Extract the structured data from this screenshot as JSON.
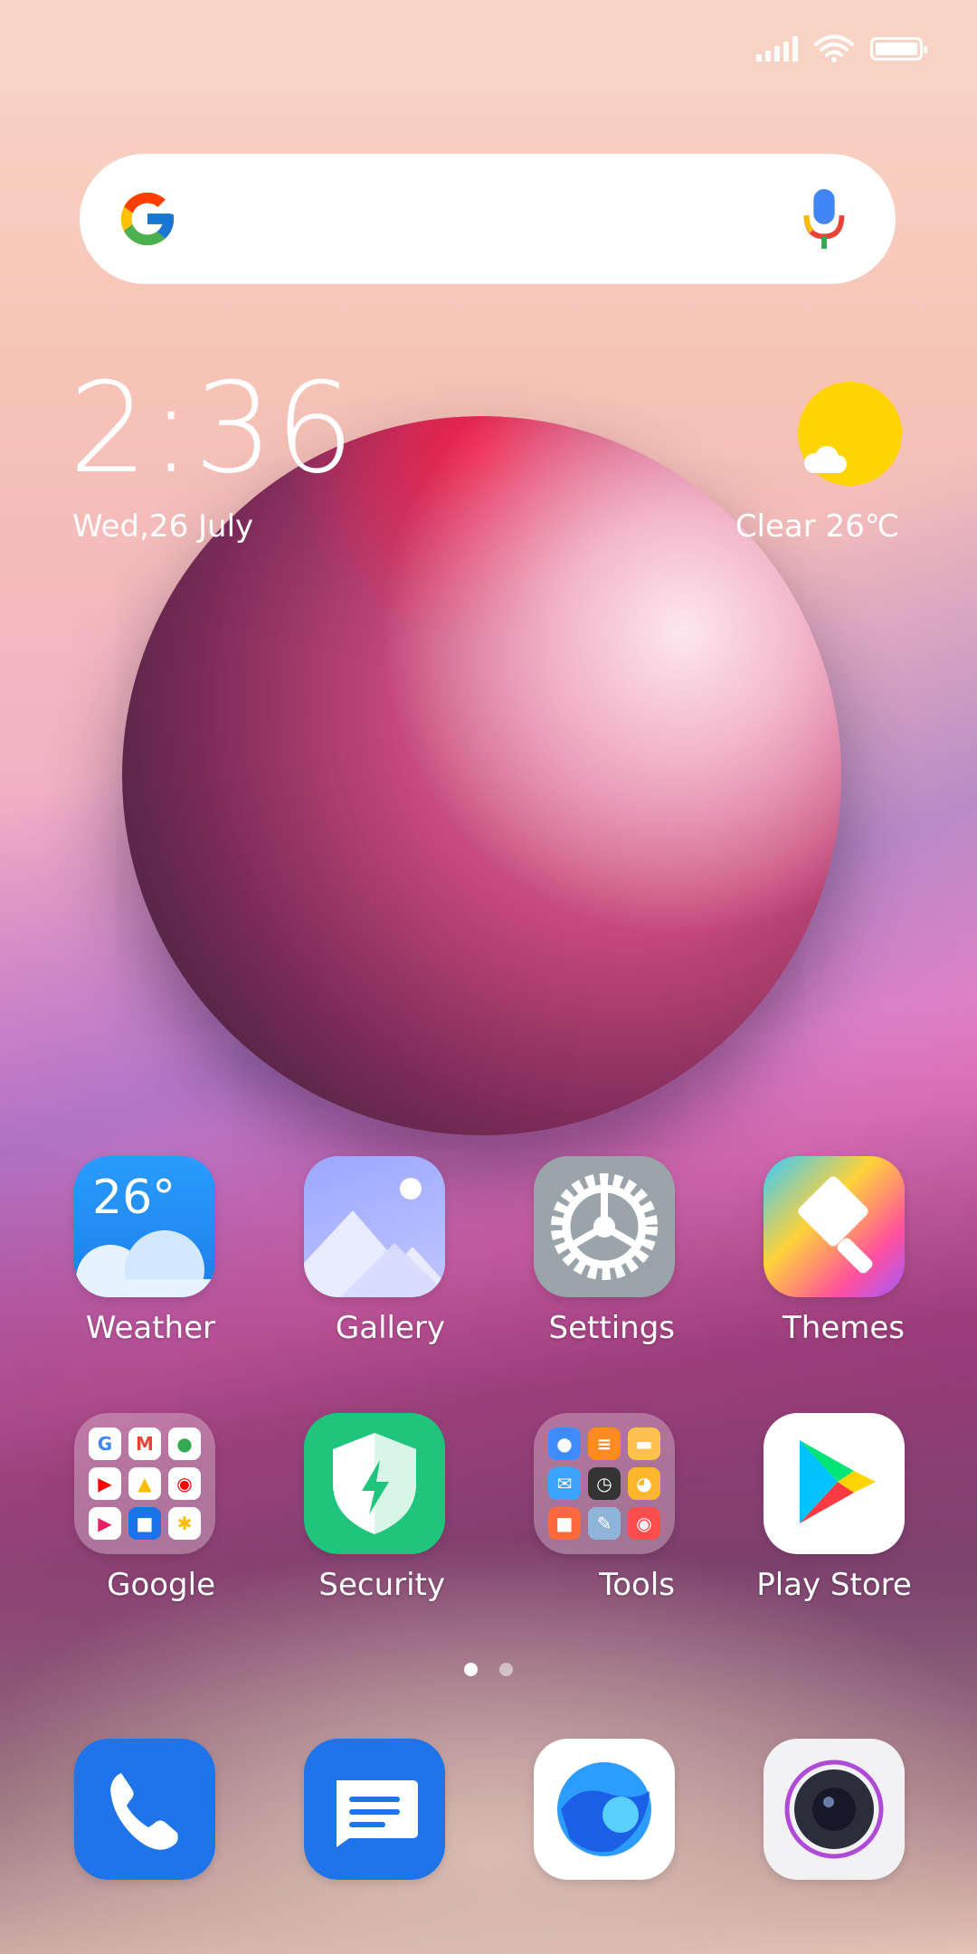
{
  "status_bar": {
    "signal_bars": 5,
    "battery": "full",
    "wifi": "connected"
  },
  "search_bar": {
    "left_icon": "google-g-icon",
    "right_icon": "microphone-icon"
  },
  "clock_widget": {
    "time": "2:36",
    "date": "Wed,26 July"
  },
  "weather_widget": {
    "icon": "sun-cloud-icon",
    "text": "Clear 26℃"
  },
  "apps_row1": [
    {
      "label": "Weather",
      "badge": "26°"
    },
    {
      "label": "Gallery"
    },
    {
      "label": "Settings"
    },
    {
      "label": "Themes"
    }
  ],
  "apps_row2": [
    {
      "label": "Google"
    },
    {
      "label": "Security"
    },
    {
      "label": "Tools"
    },
    {
      "label": "Play Store"
    }
  ],
  "page_indicator": {
    "pages": 2,
    "current": 1
  },
  "dock": [
    "phone-icon",
    "messages-icon",
    "browser-icon",
    "camera-icon"
  ],
  "colors": {
    "weather": "#1a8cff",
    "settings": "#9aa4ab",
    "security": "#1fc57c",
    "dock_blue": "#1e74e8"
  }
}
